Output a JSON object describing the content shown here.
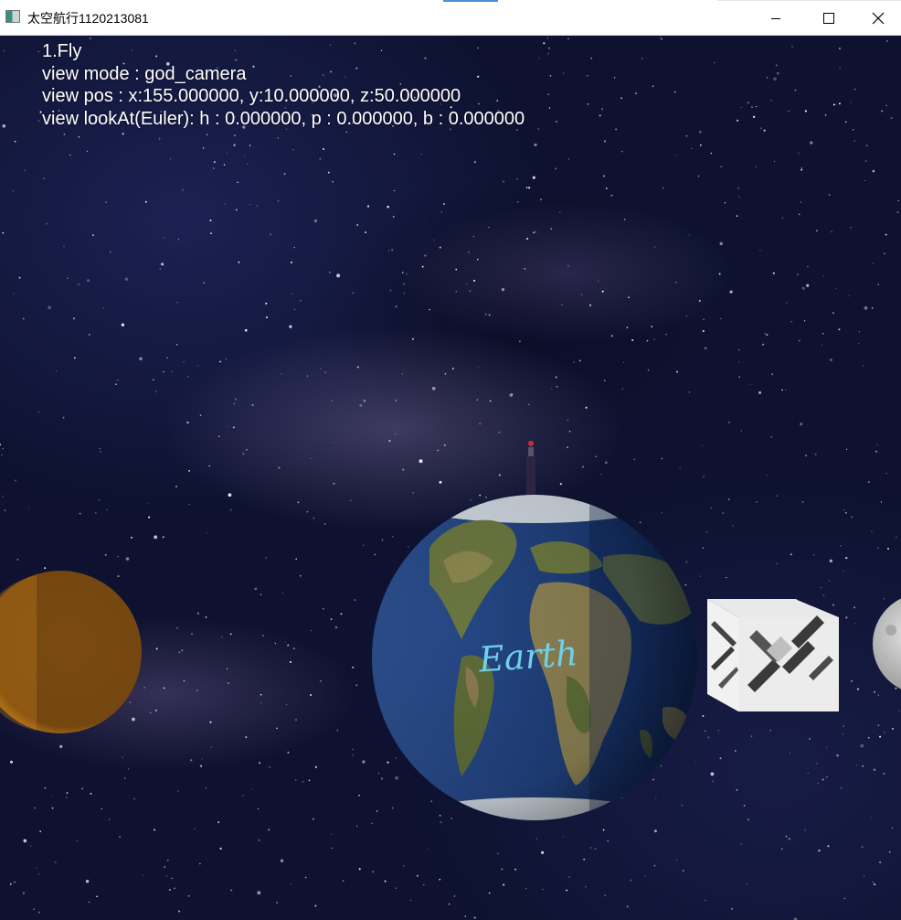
{
  "window": {
    "title": "太空航行1120213081",
    "controls": {
      "minimize": "minimize",
      "maximize": "maximize",
      "close": "close"
    }
  },
  "hud": {
    "line1": "1.Fly",
    "line2": "view mode : god_camera",
    "line3": "view pos : x:155.000000, y:10.000000, z:50.000000",
    "line4": "view lookAt(Euler): h : 0.000000, p : 0.000000, b : 0.000000"
  },
  "scene": {
    "earth_label": "Earth",
    "objects": [
      "orange-planet",
      "earth-globe",
      "rocket",
      "space-station-cube",
      "grey-moon"
    ],
    "colors": {
      "space": "#0e1230",
      "orange_planet": "#7a4a12",
      "ocean": "#1f3f7a",
      "land": "#5f6e3a",
      "earth_text": "#6fd0e8"
    }
  }
}
